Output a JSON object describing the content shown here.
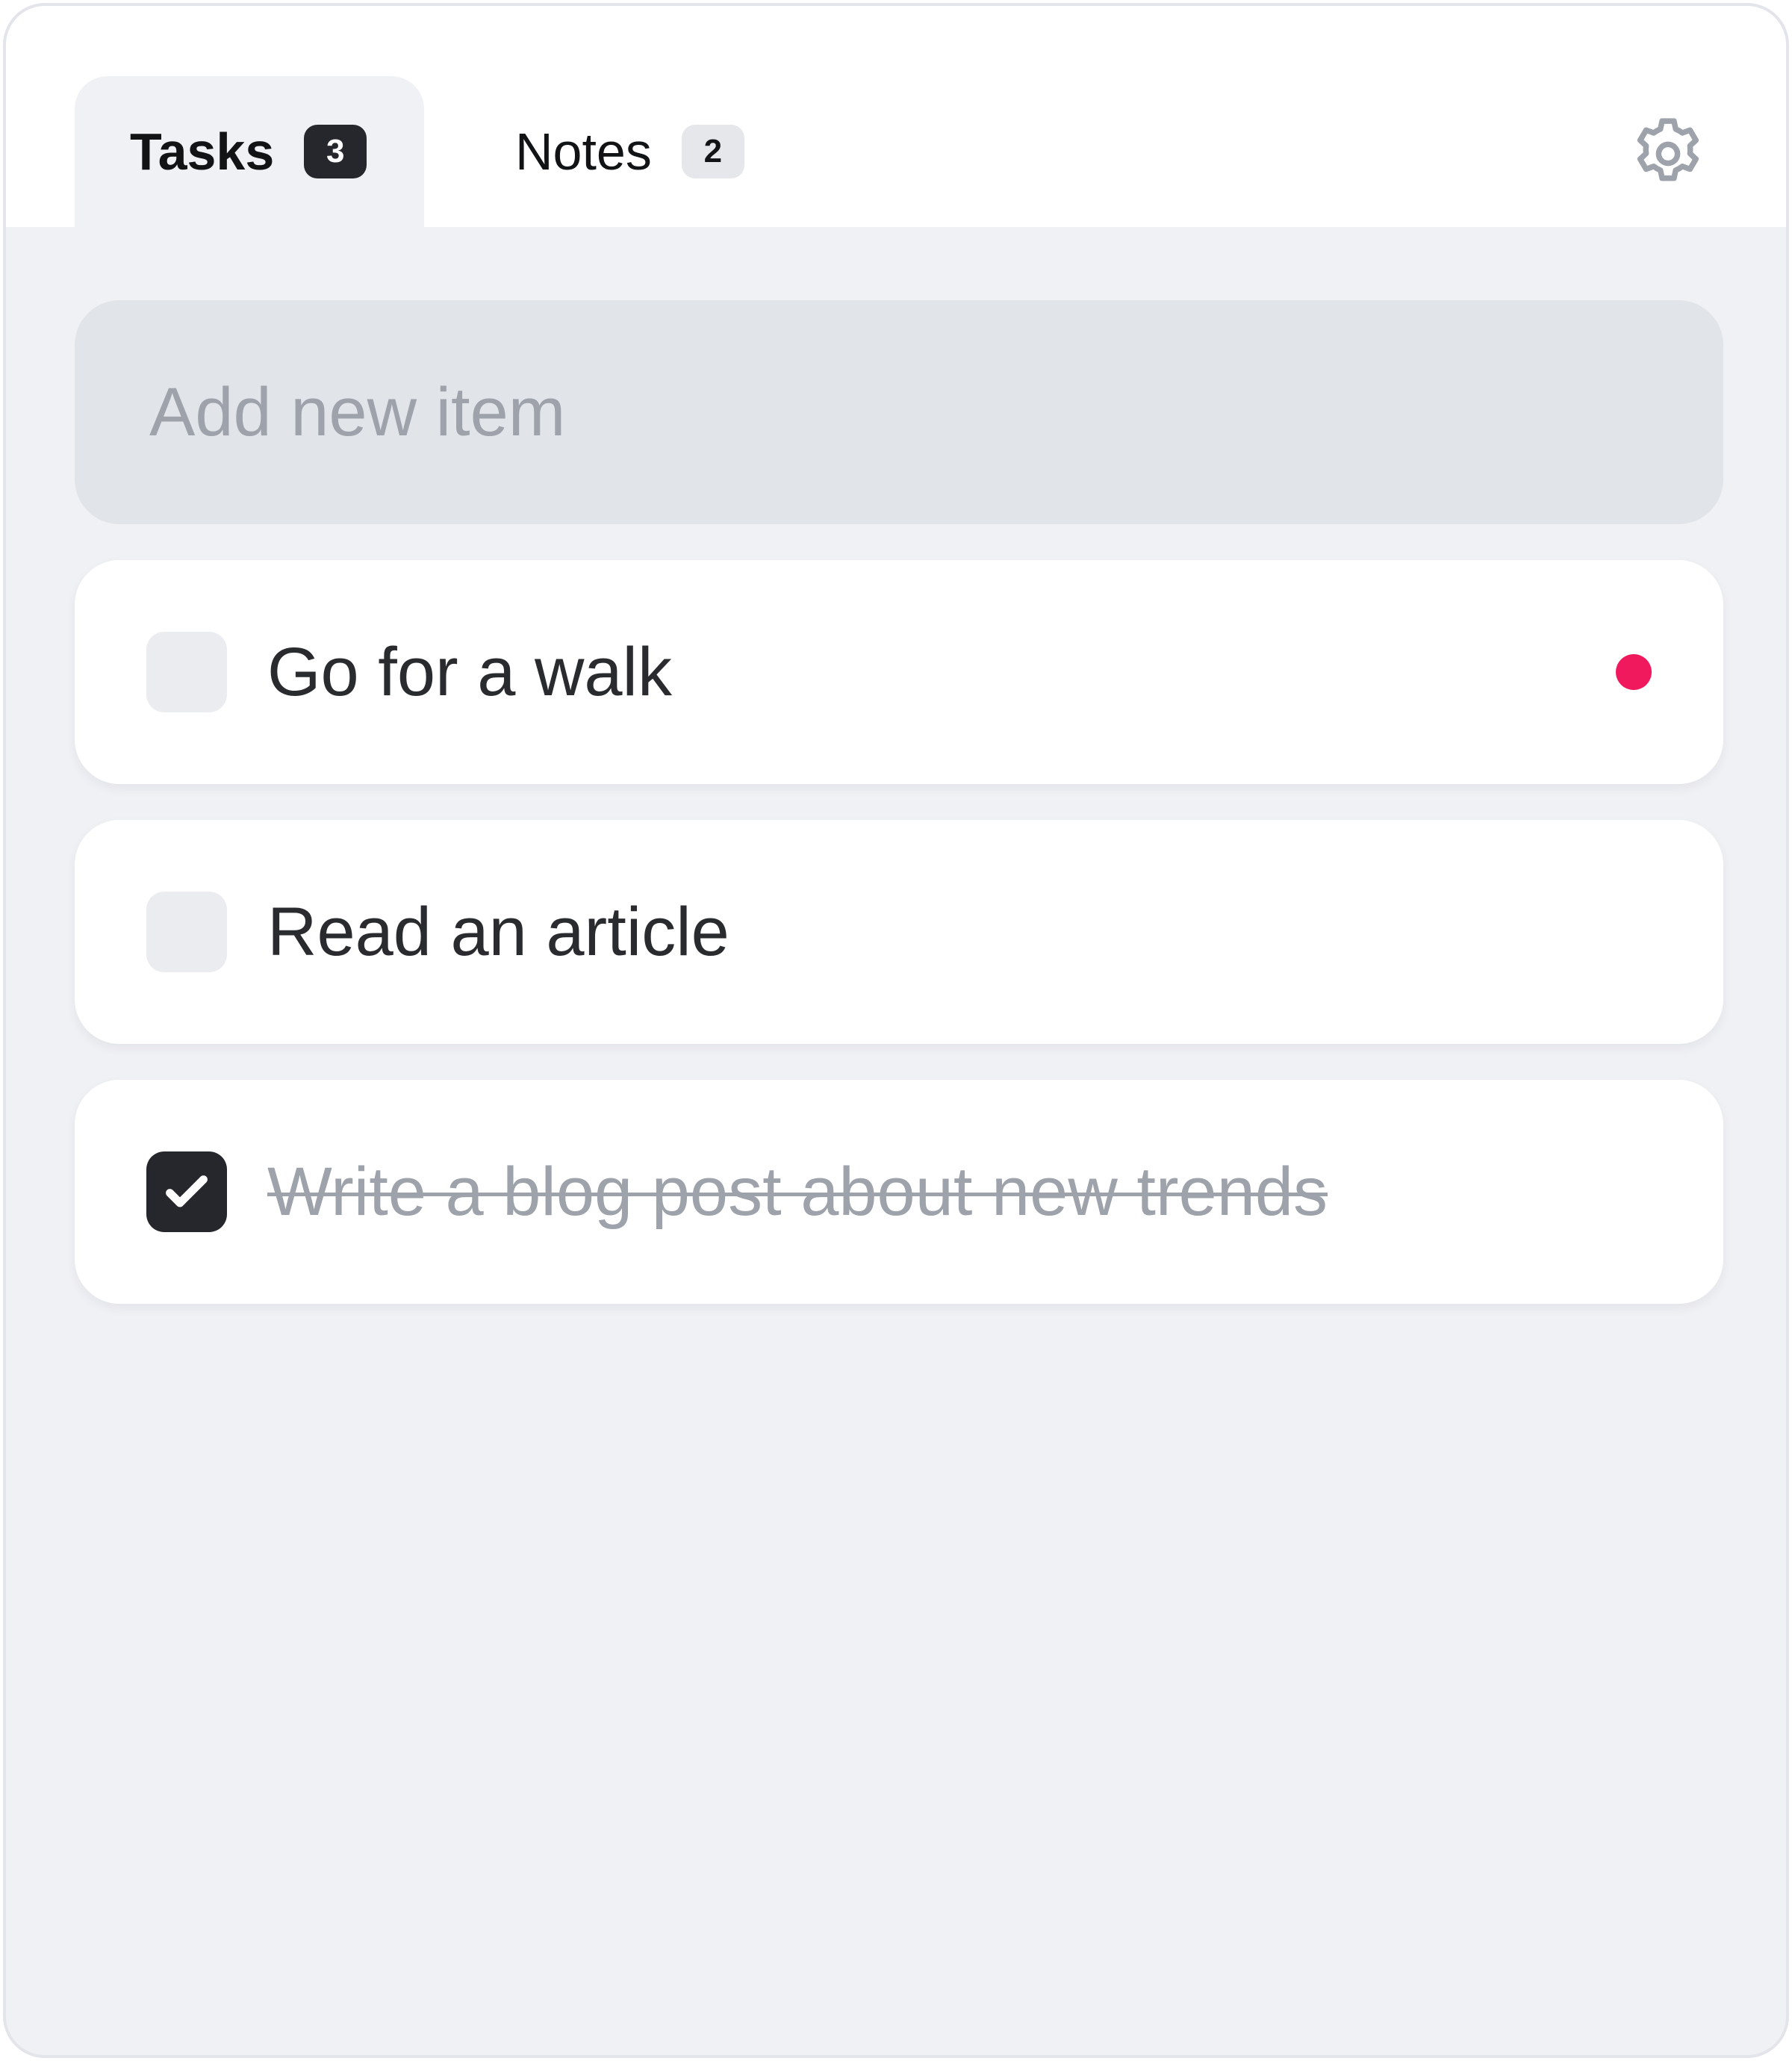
{
  "tabs": [
    {
      "label": "Tasks",
      "count": "3",
      "active": true
    },
    {
      "label": "Notes",
      "count": "2",
      "active": false
    }
  ],
  "settings": {
    "icon": "gear-icon"
  },
  "add_input": {
    "placeholder": "Add new item",
    "value": ""
  },
  "tasks": [
    {
      "text": "Go for a walk",
      "checked": false,
      "priority": true
    },
    {
      "text": "Read an article",
      "checked": false,
      "priority": false
    },
    {
      "text": "Write a blog post about new trends",
      "checked": true,
      "priority": false
    }
  ],
  "colors": {
    "priority": "#f0195e",
    "accent_dark": "#26272c",
    "background": "#f0f1f5"
  }
}
